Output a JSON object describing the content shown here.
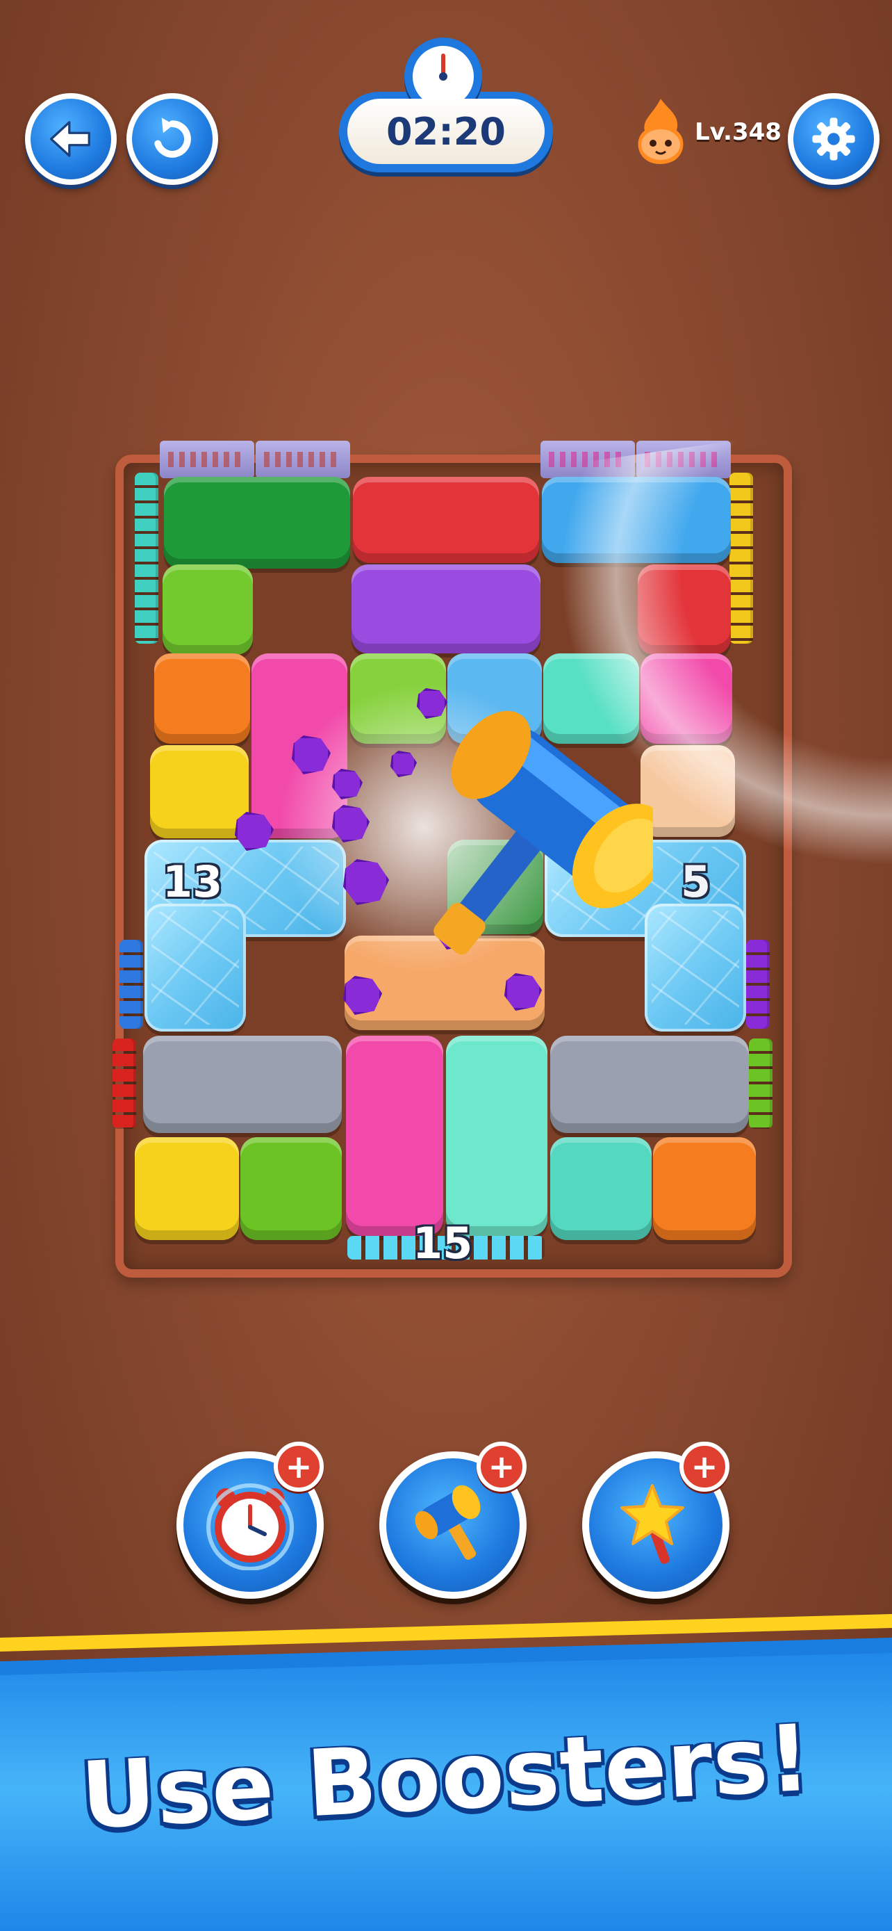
{
  "hud": {
    "timer": "02:20",
    "level": "Lv.348"
  },
  "board": {
    "counter_left": "13",
    "counter_right": "5",
    "counter_bottom": "15"
  },
  "boosters": [
    {
      "name": "time-freeze"
    },
    {
      "name": "hammer"
    },
    {
      "name": "magic-wand"
    }
  ],
  "boosters_plus": "+",
  "banner": {
    "headline": "Use Boosters!"
  },
  "colors": {
    "background": "#8a4a30",
    "button_blue": "#1f7be0",
    "banner_blue": "#1a7ee0",
    "banner_stripe": "#ffd21f",
    "board_frame": "#c05c3e"
  }
}
